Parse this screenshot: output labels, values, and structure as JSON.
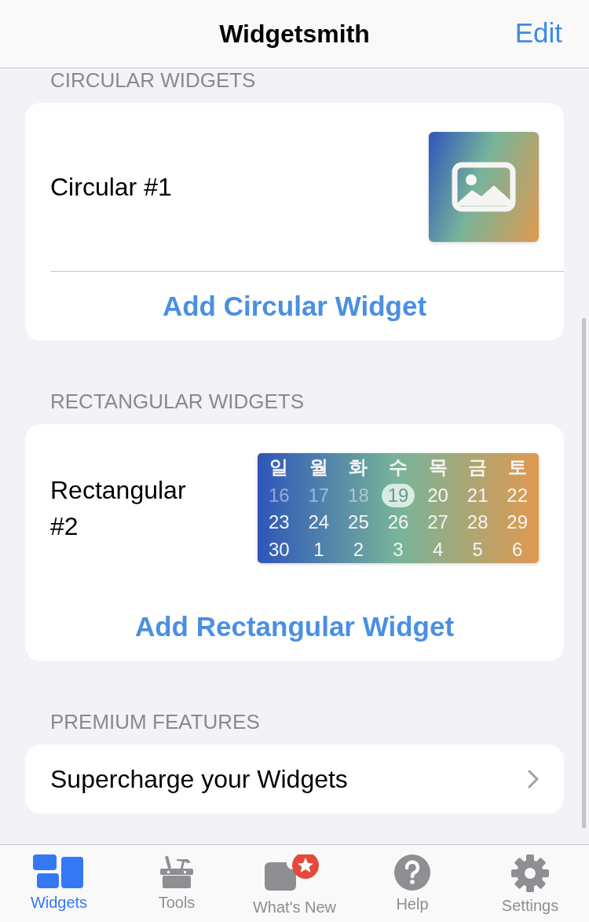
{
  "nav": {
    "title": "Widgetsmith",
    "action": "Edit"
  },
  "sections": [
    {
      "header": "CIRCULAR WIDGETS",
      "kind": "widgets",
      "items": [
        {
          "name": "Circular #1",
          "kind": "image"
        }
      ],
      "add_button": "Add Circular Widget"
    },
    {
      "header": "RECTANGULAR WIDGETS",
      "kind": "widgets",
      "items": [
        {
          "name": "Rectangular #2",
          "kind": "calendar",
          "calendar": {
            "weekdays": [
              "일",
              "월",
              "화",
              "수",
              "목",
              "금",
              "토"
            ],
            "weeks": [
              [
                {
                  "day": "16",
                  "past": true,
                  "selected": false
                },
                {
                  "day": "17",
                  "past": true,
                  "selected": false
                },
                {
                  "day": "18",
                  "past": true,
                  "selected": false
                },
                {
                  "day": "19",
                  "past": false,
                  "selected": true
                },
                {
                  "day": "20",
                  "past": false,
                  "selected": false
                },
                {
                  "day": "21",
                  "past": false,
                  "selected": false
                },
                {
                  "day": "22",
                  "past": false,
                  "selected": false
                }
              ],
              [
                {
                  "day": "23",
                  "past": false,
                  "selected": false
                },
                {
                  "day": "24",
                  "past": false,
                  "selected": false
                },
                {
                  "day": "25",
                  "past": false,
                  "selected": false
                },
                {
                  "day": "26",
                  "past": false,
                  "selected": false
                },
                {
                  "day": "27",
                  "past": false,
                  "selected": false
                },
                {
                  "day": "28",
                  "past": false,
                  "selected": false
                },
                {
                  "day": "29",
                  "past": false,
                  "selected": false
                }
              ],
              [
                {
                  "day": "30",
                  "past": false,
                  "selected": false
                },
                {
                  "day": "1",
                  "past": false,
                  "selected": false
                },
                {
                  "day": "2",
                  "past": false,
                  "selected": false
                },
                {
                  "day": "3",
                  "past": false,
                  "selected": false
                },
                {
                  "day": "4",
                  "past": false,
                  "selected": false
                },
                {
                  "day": "5",
                  "past": false,
                  "selected": false
                },
                {
                  "day": "6",
                  "past": false,
                  "selected": false
                }
              ]
            ]
          }
        }
      ],
      "add_button": "Add Rectangular Widget"
    },
    {
      "header": "PREMIUM FEATURES",
      "kind": "link",
      "label": "Supercharge your Widgets"
    }
  ],
  "tab_bar": [
    {
      "label": "Widgets",
      "kind": "widgets",
      "selected": true
    },
    {
      "label": "Tools",
      "kind": "tools",
      "selected": false
    },
    {
      "label": "What's New",
      "kind": "news",
      "selected": false
    },
    {
      "label": "Help",
      "kind": "help",
      "selected": false
    },
    {
      "label": "Settings",
      "kind": "settings",
      "selected": false
    }
  ]
}
